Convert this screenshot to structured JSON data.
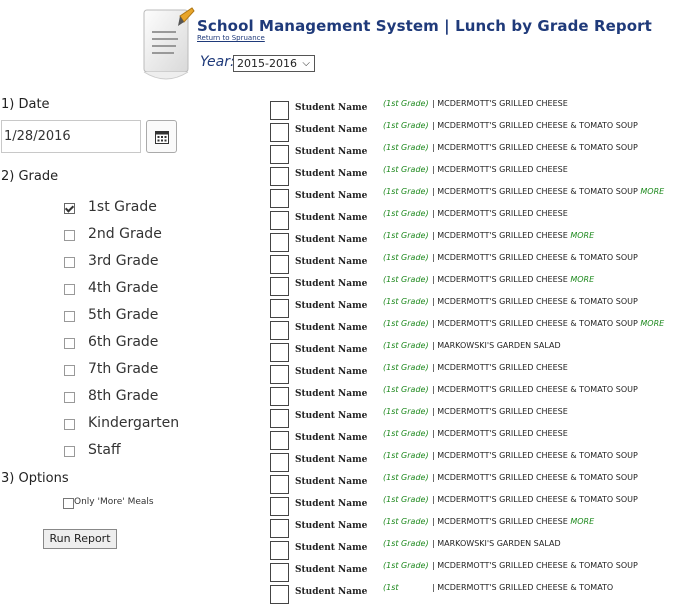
{
  "header": {
    "title": "School Management System | Lunch by Grade Report",
    "return_link": "Return to Spruance",
    "year_label": "Year:",
    "year_value": "2015-2016"
  },
  "sidebar": {
    "date_heading": "1) Date",
    "date_value": "1/28/2016",
    "grade_heading": "2) Grade",
    "grades": [
      {
        "label": "1st Grade",
        "checked": true
      },
      {
        "label": "2nd Grade",
        "checked": false
      },
      {
        "label": "3rd Grade",
        "checked": false
      },
      {
        "label": "4th Grade",
        "checked": false
      },
      {
        "label": "5th Grade",
        "checked": false
      },
      {
        "label": "6th Grade",
        "checked": false
      },
      {
        "label": "7th Grade",
        "checked": false
      },
      {
        "label": "8th Grade",
        "checked": false
      },
      {
        "label": "Kindergarten",
        "checked": false
      },
      {
        "label": "Staff",
        "checked": false
      }
    ],
    "options_heading": "3) Options",
    "only_more_label": "Only 'More' Meals",
    "run_button": "Run Report"
  },
  "colors": {
    "title": "#1f3a7a",
    "grade_tag": "#1f8a1f",
    "more": "#1f8a1f"
  },
  "report": {
    "more_label": "MORE",
    "rows": [
      {
        "name": "Student Name",
        "grade": "(1st Grade)",
        "meal": "| MCDERMOTT'S GRILLED CHEESE",
        "more": false
      },
      {
        "name": "Student Name",
        "grade": "(1st Grade)",
        "meal": "| MCDERMOTT'S GRILLED CHEESE & TOMATO SOUP",
        "more": false
      },
      {
        "name": "Student Name",
        "grade": "(1st Grade)",
        "meal": "| MCDERMOTT'S GRILLED CHEESE & TOMATO SOUP",
        "more": false
      },
      {
        "name": "Student Name",
        "grade": "(1st Grade)",
        "meal": "| MCDERMOTT'S GRILLED CHEESE",
        "more": false
      },
      {
        "name": "Student Name",
        "grade": "(1st Grade)",
        "meal": "| MCDERMOTT'S GRILLED CHEESE & TOMATO SOUP",
        "more": true
      },
      {
        "name": "Student Name",
        "grade": "(1st Grade)",
        "meal": "| MCDERMOTT'S GRILLED CHEESE",
        "more": false
      },
      {
        "name": "Student Name",
        "grade": "(1st Grade)",
        "meal": "| MCDERMOTT'S GRILLED CHEESE",
        "more": true
      },
      {
        "name": "Student Name",
        "grade": "(1st Grade)",
        "meal": "| MCDERMOTT'S GRILLED CHEESE & TOMATO SOUP",
        "more": false
      },
      {
        "name": "Student Name",
        "grade": "(1st Grade)",
        "meal": "| MCDERMOTT'S GRILLED CHEESE",
        "more": true
      },
      {
        "name": "Student Name",
        "grade": "(1st Grade)",
        "meal": "| MCDERMOTT'S GRILLED CHEESE & TOMATO SOUP",
        "more": false
      },
      {
        "name": "Student Name",
        "grade": "(1st Grade)",
        "meal": "| MCDERMOTT'S GRILLED CHEESE & TOMATO SOUP",
        "more": true
      },
      {
        "name": "Student Name",
        "grade": "(1st Grade)",
        "meal": "| MARKOWSKI'S GARDEN SALAD",
        "more": false
      },
      {
        "name": "Student Name",
        "grade": "(1st Grade)",
        "meal": "| MCDERMOTT'S GRILLED CHEESE",
        "more": false
      },
      {
        "name": "Student Name",
        "grade": "(1st Grade)",
        "meal": "| MCDERMOTT'S GRILLED CHEESE & TOMATO SOUP",
        "more": false
      },
      {
        "name": "Student Name",
        "grade": "(1st Grade)",
        "meal": "| MCDERMOTT'S GRILLED CHEESE",
        "more": false
      },
      {
        "name": "Student Name",
        "grade": "(1st Grade)",
        "meal": "| MCDERMOTT'S GRILLED CHEESE",
        "more": false
      },
      {
        "name": "Student Name",
        "grade": "(1st Grade)",
        "meal": "| MCDERMOTT'S GRILLED CHEESE & TOMATO SOUP",
        "more": false
      },
      {
        "name": "Student Name",
        "grade": "(1st Grade)",
        "meal": "| MCDERMOTT'S GRILLED CHEESE & TOMATO SOUP",
        "more": false
      },
      {
        "name": "Student Name",
        "grade": "(1st Grade)",
        "meal": "| MCDERMOTT'S GRILLED CHEESE & TOMATO SOUP",
        "more": false
      },
      {
        "name": "Student Name",
        "grade": "(1st Grade)",
        "meal": "| MCDERMOTT'S GRILLED CHEESE",
        "more": true
      },
      {
        "name": "Student Name",
        "grade": "(1st Grade)",
        "meal": "| MARKOWSKI'S GARDEN SALAD",
        "more": false
      },
      {
        "name": "Student Name",
        "grade": "(1st Grade)",
        "meal": "| MCDERMOTT'S GRILLED CHEESE & TOMATO SOUP",
        "more": false
      },
      {
        "name": "Student Name",
        "grade": "(1st",
        "meal": "| MCDERMOTT'S GRILLED CHEESE & TOMATO",
        "more": false
      }
    ]
  }
}
